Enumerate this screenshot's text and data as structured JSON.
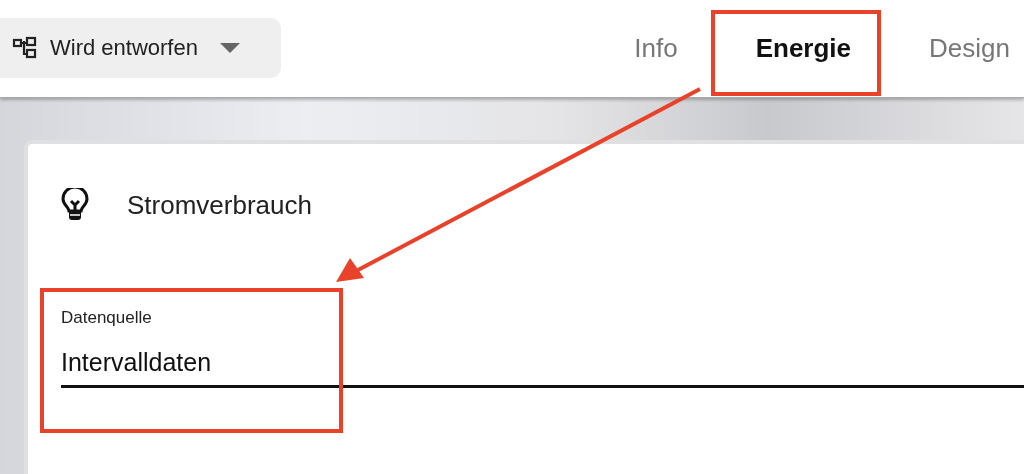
{
  "status_menu": {
    "label": "Wird entworfen"
  },
  "tabs": [
    {
      "label": "Info",
      "selected": false
    },
    {
      "label": "Energie",
      "selected": true
    },
    {
      "label": "Design",
      "selected": false
    }
  ],
  "card": {
    "title": "Stromverbrauch",
    "field": {
      "label": "Datenquelle",
      "value": "Intervalldaten"
    }
  }
}
